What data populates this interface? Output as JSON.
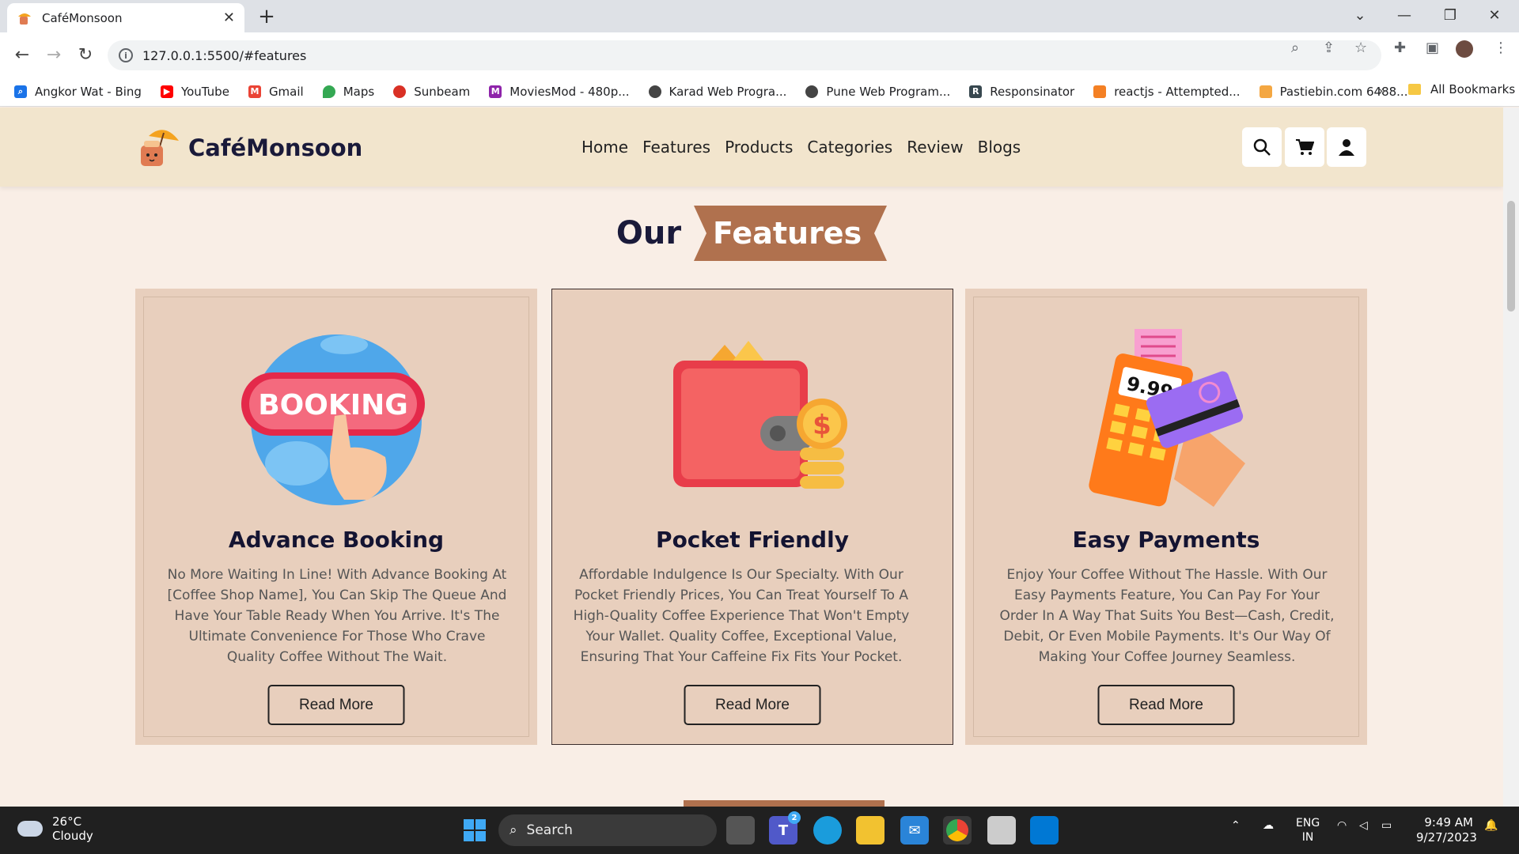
{
  "browser": {
    "tab_title": "CaféMonsoon",
    "tab_close": "✕",
    "new_tab": "+",
    "url": "127.0.0.1:5500/#features",
    "bookmarks": [
      {
        "label": "Angkor Wat - Bing",
        "color": "#1a73e8"
      },
      {
        "label": "YouTube",
        "color": "#ff0000"
      },
      {
        "label": "Gmail",
        "color": "#ea4335"
      },
      {
        "label": "Maps",
        "color": "#34a853"
      },
      {
        "label": "Sunbeam",
        "color": "#d93025"
      },
      {
        "label": "MoviesMod - 480p...",
        "color": "#8e24aa"
      },
      {
        "label": "Karad Web Progra...",
        "color": "#444444"
      },
      {
        "label": "Pune Web Program...",
        "color": "#444444"
      },
      {
        "label": "Responsinator",
        "color": "#37474f"
      },
      {
        "label": "reactjs - Attempted...",
        "color": "#f48024"
      },
      {
        "label": "Pastiebin.com 6488...",
        "color": "#f4a742"
      }
    ],
    "bookmarks_more": "»",
    "all_bookmarks": "All Bookmarks"
  },
  "site": {
    "logo_text": "CaféMonsoon",
    "nav": [
      "Home",
      "Features",
      "Products",
      "Categories",
      "Review",
      "Blogs"
    ],
    "section_title_plain": "Our",
    "section_title_highlight": "Features",
    "accent_color": "#b0714e",
    "cards": [
      {
        "title": "Advance Booking",
        "text": "No More Waiting In Line! With Advance Booking At [Coffee Shop Name], You Can Skip The Queue And Have Your Table Ready When You Arrive. It's The Ultimate Convenience For Those Who Crave Quality Coffee Without The Wait.",
        "button": "Read More",
        "illustration_text": "BOOKING"
      },
      {
        "title": "Pocket Friendly",
        "text": "Affordable Indulgence Is Our Specialty. With Our Pocket Friendly Prices, You Can Treat Yourself To A High-Quality Coffee Experience That Won't Empty Your Wallet. Quality Coffee, Exceptional Value, Ensuring That Your Caffeine Fix Fits Your Pocket.",
        "button": "Read More",
        "illustration_text": "$"
      },
      {
        "title": "Easy Payments",
        "text": "Enjoy Your Coffee Without The Hassle. With Our Easy Payments Feature, You Can Pay For Your Order In A Way That Suits You Best—Cash, Credit, Debit, Or Even Mobile Payments. It's Our Way Of Making Your Coffee Journey Seamless.",
        "button": "Read More",
        "illustration_text": "9.99"
      }
    ]
  },
  "taskbar": {
    "temperature": "26°C",
    "weather": "Cloudy",
    "search": "Search",
    "teams_badge": "2",
    "lang_top": "ENG",
    "lang_bottom": "IN",
    "time": "9:49 AM",
    "date": "9/27/2023"
  }
}
